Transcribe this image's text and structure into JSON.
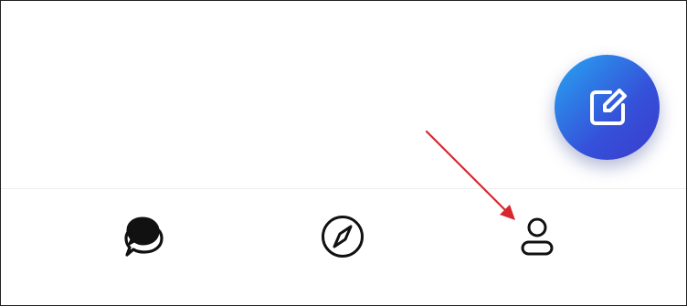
{
  "screen": {
    "background": "#ffffff",
    "nav_divider_color": "#efefef"
  },
  "fab": {
    "icon": "compose-icon",
    "gradient_start": "#27a6f2",
    "gradient_end": "#3a3ccc"
  },
  "bottom_nav": {
    "tabs": [
      {
        "icon": "chat-bubbles-icon",
        "active": true
      },
      {
        "icon": "compass-icon",
        "active": false
      },
      {
        "icon": "profile-icon",
        "active": false
      }
    ]
  },
  "annotation": {
    "type": "arrow",
    "color": "#d9262e",
    "target": "profile-tab"
  }
}
